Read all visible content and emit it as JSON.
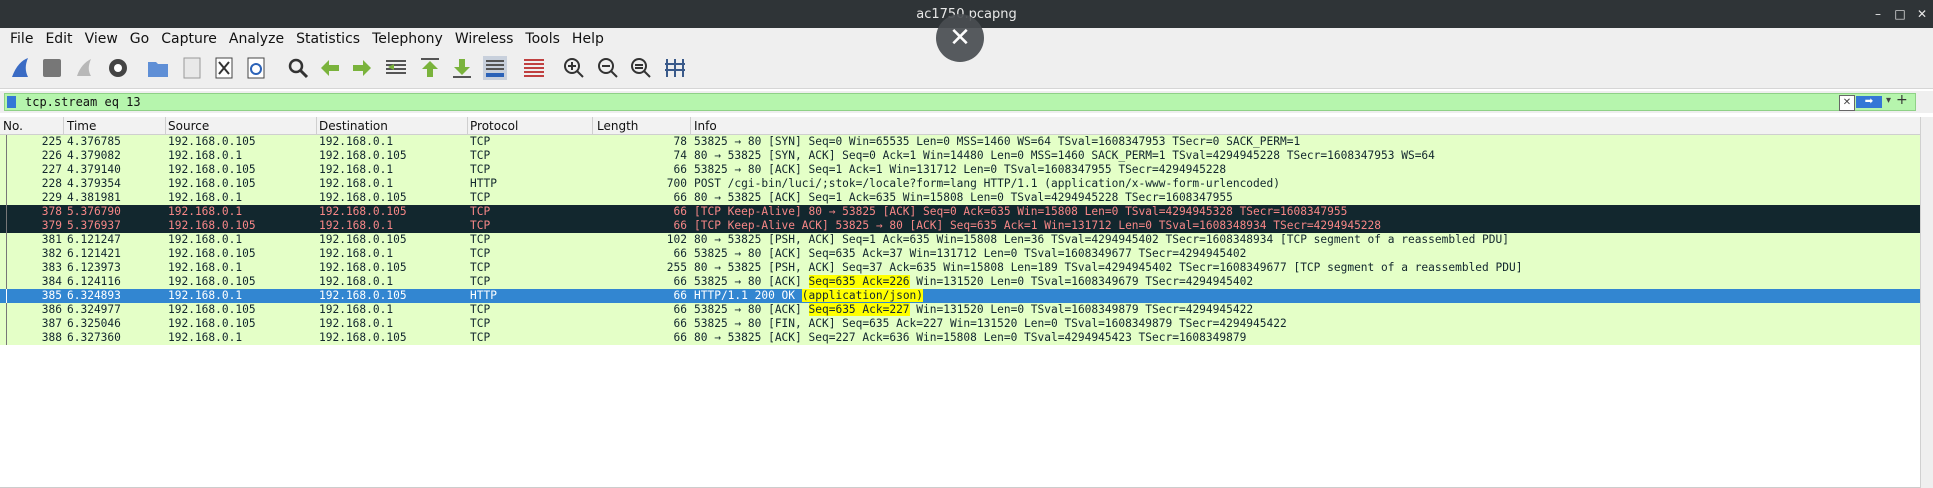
{
  "window": {
    "title": "ac1750.pcapng",
    "buttons": [
      "–",
      "□",
      "✕"
    ]
  },
  "overlay_close": "✕",
  "menu": [
    "File",
    "Edit",
    "View",
    "Go",
    "Capture",
    "Analyze",
    "Statistics",
    "Telephony",
    "Wireless",
    "Tools",
    "Help"
  ],
  "toolbar_icons": [
    "shark-fin-start-icon",
    "stop-icon",
    "restart-icon",
    "options-gear-icon",
    "open-folder-icon",
    "save-file-icon",
    "close-file-icon",
    "reload-icon",
    "find-icon",
    "go-back-icon",
    "go-forward-icon",
    "go-to-packet-icon",
    "go-first-icon",
    "go-last-icon",
    "autoscroll-icon",
    "colorize-icon",
    "zoom-in-icon",
    "zoom-out-icon",
    "zoom-normal-icon",
    "resize-columns-icon"
  ],
  "filter": {
    "value": "tcp.stream eq 13",
    "clear_label": "✕",
    "apply_label": "➡",
    "dropdown": "▾",
    "add": "+"
  },
  "columns": [
    "No.",
    "Time",
    "Source",
    "Destination",
    "Protocol",
    "Length",
    "Info"
  ],
  "packets": [
    {
      "no": "225",
      "time": "4.376785",
      "src": "192.168.0.105",
      "dst": "192.168.0.1",
      "proto": "TCP",
      "len": "78",
      "info": "53825 → 80 [SYN] Seq=0 Win=65535 Len=0 MSS=1460 WS=64 TSval=1608347953 TSecr=0 SACK_PERM=1",
      "style": "normal"
    },
    {
      "no": "226",
      "time": "4.379082",
      "src": "192.168.0.1",
      "dst": "192.168.0.105",
      "proto": "TCP",
      "len": "74",
      "info": "80 → 53825 [SYN, ACK] Seq=0 Ack=1 Win=14480 Len=0 MSS=1460 SACK_PERM=1 TSval=4294945228 TSecr=1608347953 WS=64",
      "style": "normal"
    },
    {
      "no": "227",
      "time": "4.379140",
      "src": "192.168.0.105",
      "dst": "192.168.0.1",
      "proto": "TCP",
      "len": "66",
      "info": "53825 → 80 [ACK] Seq=1 Ack=1 Win=131712 Len=0 TSval=1608347955 TSecr=4294945228",
      "style": "normal"
    },
    {
      "no": "228",
      "time": "4.379354",
      "src": "192.168.0.105",
      "dst": "192.168.0.1",
      "proto": "HTTP",
      "len": "700",
      "info": "POST /cgi-bin/luci/;stok=/locale?form=lang HTTP/1.1  (application/x-www-form-urlencoded)",
      "style": "normal"
    },
    {
      "no": "229",
      "time": "4.381981",
      "src": "192.168.0.1",
      "dst": "192.168.0.105",
      "proto": "TCP",
      "len": "66",
      "info": "80 → 53825 [ACK] Seq=1 Ack=635 Win=15808 Len=0 TSval=4294945228 TSecr=1608347955",
      "style": "normal"
    },
    {
      "no": "378",
      "time": "5.376790",
      "src": "192.168.0.1",
      "dst": "192.168.0.105",
      "proto": "TCP",
      "len": "66",
      "info": "[TCP Keep-Alive] 80 → 53825 [ACK] Seq=0 Ack=635 Win=15808 Len=0 TSval=4294945328 TSecr=1608347955",
      "style": "bad"
    },
    {
      "no": "379",
      "time": "5.376937",
      "src": "192.168.0.105",
      "dst": "192.168.0.1",
      "proto": "TCP",
      "len": "66",
      "info": "[TCP Keep-Alive ACK] 53825 → 80 [ACK] Seq=635 Ack=1 Win=131712 Len=0 TSval=1608348934 TSecr=4294945228",
      "style": "bad"
    },
    {
      "no": "381",
      "time": "6.121247",
      "src": "192.168.0.1",
      "dst": "192.168.0.105",
      "proto": "TCP",
      "len": "102",
      "info": "80 → 53825 [PSH, ACK] Seq=1 Ack=635 Win=15808 Len=36 TSval=4294945402 TSecr=1608348934 [TCP segment of a reassembled PDU]",
      "style": "normal"
    },
    {
      "no": "382",
      "time": "6.121421",
      "src": "192.168.0.105",
      "dst": "192.168.0.1",
      "proto": "TCP",
      "len": "66",
      "info": "53825 → 80 [ACK] Seq=635 Ack=37 Win=131712 Len=0 TSval=1608349677 TSecr=4294945402",
      "style": "normal"
    },
    {
      "no": "383",
      "time": "6.123973",
      "src": "192.168.0.1",
      "dst": "192.168.0.105",
      "proto": "TCP",
      "len": "255",
      "info": "80 → 53825 [PSH, ACK] Seq=37 Ack=635 Win=15808 Len=189 TSval=4294945402 TSecr=1608349677 [TCP segment of a reassembled PDU]",
      "style": "normal"
    },
    {
      "no": "384",
      "time": "6.124116",
      "src": "192.168.0.105",
      "dst": "192.168.0.1",
      "proto": "TCP",
      "len": "66",
      "info_parts": [
        "53825 → 80 [ACK] ",
        "Seq=635 Ack=226",
        " Win=131520 Len=0 TSval=1608349679 TSecr=4294945402"
      ],
      "style": "normal"
    },
    {
      "no": "385",
      "time": "6.324893",
      "src": "192.168.0.1",
      "dst": "192.168.0.105",
      "proto": "HTTP",
      "len": "66",
      "info_parts": [
        "HTTP/1.1 200 OK  ",
        "(application/json)",
        ""
      ],
      "style": "sel"
    },
    {
      "no": "386",
      "time": "6.324977",
      "src": "192.168.0.105",
      "dst": "192.168.0.1",
      "proto": "TCP",
      "len": "66",
      "info_parts": [
        "53825 → 80 [ACK] ",
        "Seq=635 Ack=227",
        " Win=131520 Len=0 TSval=1608349879 TSecr=4294945422"
      ],
      "style": "normal"
    },
    {
      "no": "387",
      "time": "6.325046",
      "src": "192.168.0.105",
      "dst": "192.168.0.1",
      "proto": "TCP",
      "len": "66",
      "info": "53825 → 80 [FIN, ACK] Seq=635 Ack=227 Win=131520 Len=0 TSval=1608349879 TSecr=4294945422",
      "style": "normal"
    },
    {
      "no": "388",
      "time": "6.327360",
      "src": "192.168.0.1",
      "dst": "192.168.0.105",
      "proto": "TCP",
      "len": "66",
      "info": "80 → 53825 [ACK] Seq=227 Ack=636 Win=15808 Len=0 TSval=4294945423 TSecr=1608349879",
      "style": "normal"
    }
  ]
}
